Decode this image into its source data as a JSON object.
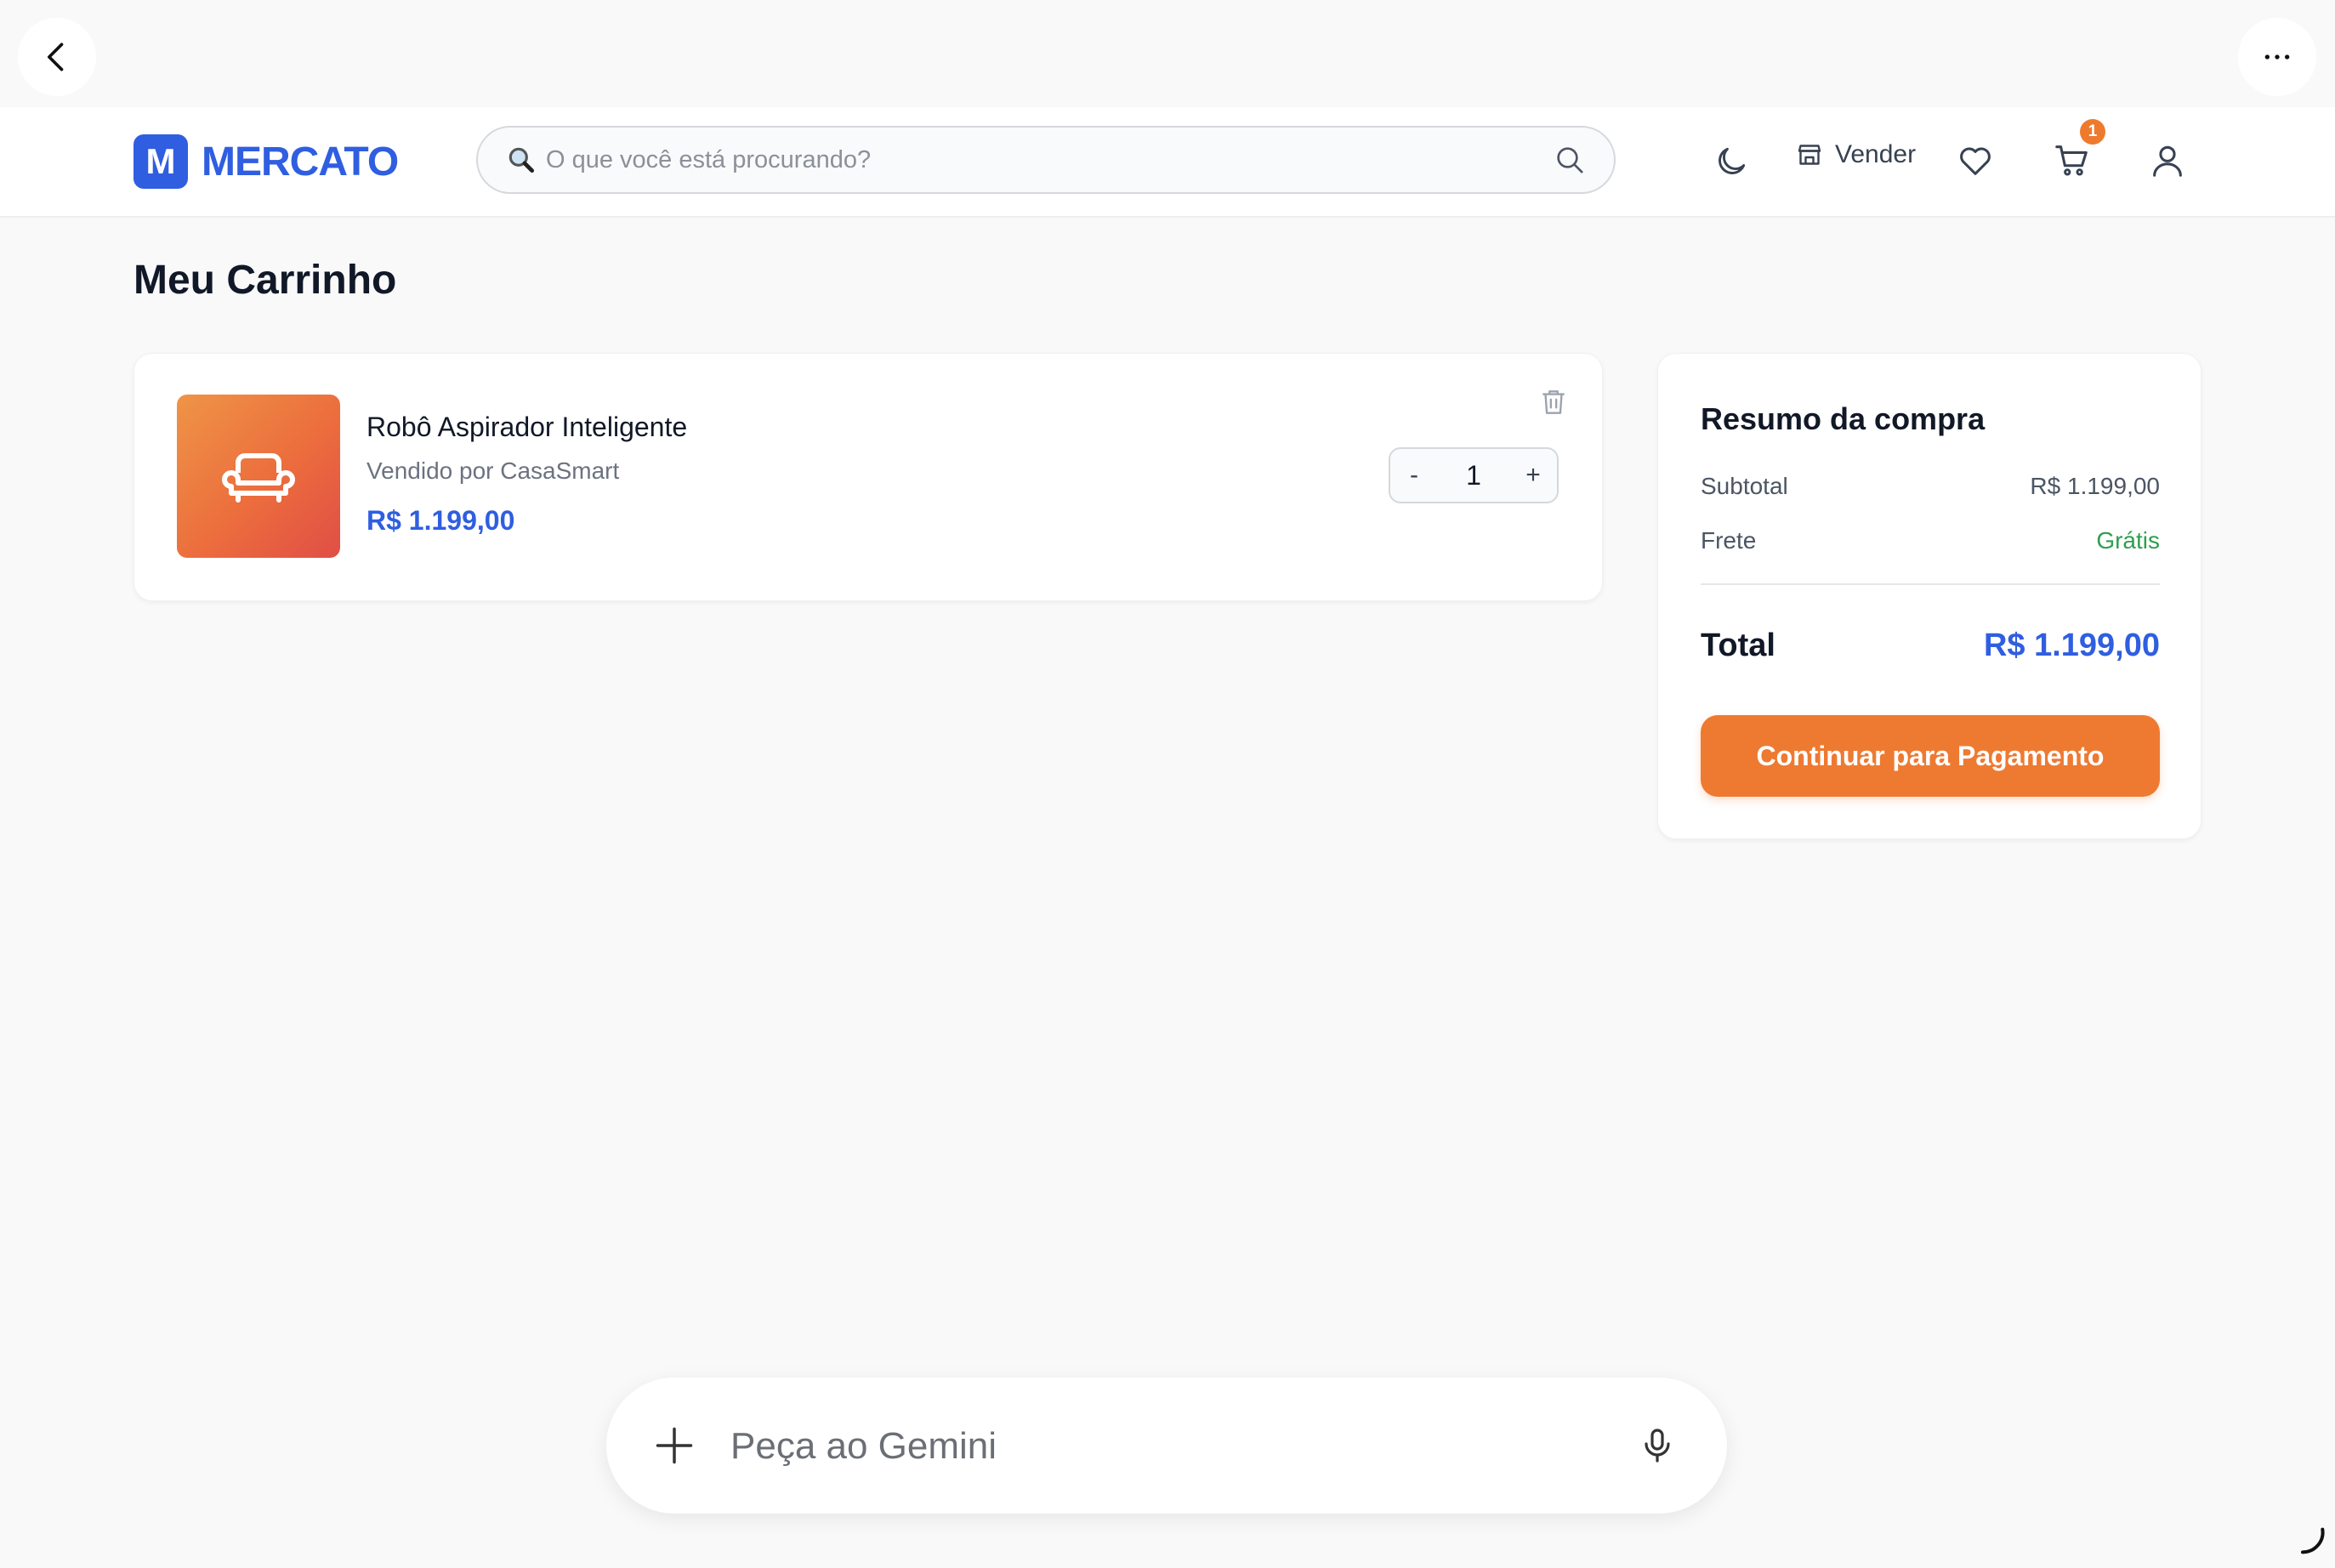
{
  "header": {
    "logo_letter": "M",
    "logo_text": "MERCATO",
    "search_placeholder": "O que você está procurando?",
    "sell_label": "Vender",
    "cart_count": "1"
  },
  "page": {
    "title": "Meu Carrinho"
  },
  "cart_items": [
    {
      "name": "Robô Aspirador Inteligente",
      "seller": "Vendido por CasaSmart",
      "price": "R$ 1.199,00",
      "quantity": "1",
      "decrement_label": "-",
      "increment_label": "+",
      "image_icon": "sofa-icon"
    }
  ],
  "summary": {
    "title": "Resumo da compra",
    "subtotal_label": "Subtotal",
    "subtotal_value": "R$ 1.199,00",
    "shipping_label": "Frete",
    "shipping_value": "Grátis",
    "total_label": "Total",
    "total_value": "R$ 1.199,00",
    "checkout_label": "Continuar para Pagamento"
  },
  "assistant_bar": {
    "placeholder": "Peça ao Gemini"
  },
  "colors": {
    "brand_blue": "#2f5ee0",
    "accent_orange": "#ee7a32",
    "free_shipping_green": "#2e9e4f",
    "page_bg": "#f9f9fa"
  },
  "icons": [
    "back-arrow-icon",
    "more-options-icon",
    "search-icon",
    "moon-icon",
    "store-icon",
    "heart-icon",
    "cart-icon",
    "user-icon",
    "trash-icon",
    "sofa-icon",
    "plus-icon",
    "microphone-icon"
  ]
}
